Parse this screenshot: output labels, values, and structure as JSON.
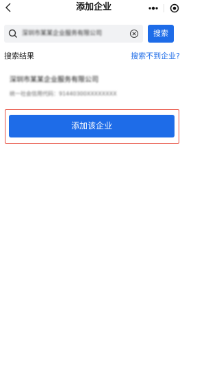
{
  "nav": {
    "title": "添加企业",
    "back_icon": "chevron-left-icon",
    "more_icon": "more-dots-icon",
    "close_icon": "target-close-icon"
  },
  "search": {
    "query": "深圳市某某企业服务有限公司",
    "search_icon": "search-icon",
    "clear_icon": "clear-circle-icon",
    "button_label": "搜索"
  },
  "results": {
    "label": "搜索结果",
    "not_found_link": "搜索不到企业?",
    "items": [
      {
        "name": "深圳市某某企业服务有限公司",
        "credit_code": "统一社会信用代码：91440300XXXXXXXX"
      }
    ]
  },
  "actions": {
    "add_label": "添加该企业"
  },
  "colors": {
    "accent": "#1e6ce8",
    "highlight_border": "#e74a3b",
    "search_bg": "#f1f2f4"
  }
}
